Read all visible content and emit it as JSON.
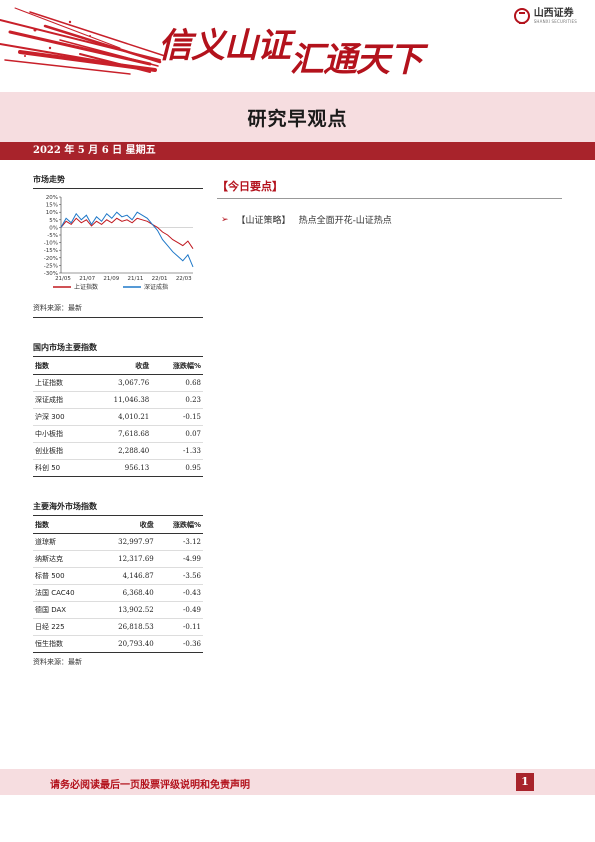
{
  "header": {
    "slogan_part1": "信义山证",
    "slogan_part2": "汇通天下",
    "logo_cn": "山西证券",
    "logo_en": "SHANXI SECURITIES"
  },
  "title": "研究早观点",
  "date_line": "2022 年 5 月 6 日    星期五",
  "market_trend": {
    "title": "市场走势",
    "source": "资料来源：最新",
    "chart_data": {
      "type": "line",
      "x": [
        "21/05",
        "21/07",
        "21/09",
        "21/11",
        "22/01",
        "22/03"
      ],
      "yticks": [
        "20%",
        "15%",
        "10%",
        "5%",
        "0%",
        "-5%",
        "-10%",
        "-15%",
        "-20%",
        "-25%",
        "-30%"
      ],
      "ylim": [
        -30,
        20
      ],
      "series": [
        {
          "name": "上证指数",
          "color": "#c0181f",
          "values": [
            0,
            4,
            2,
            6,
            3,
            5,
            1,
            4,
            2,
            5,
            3,
            6,
            4,
            5,
            3,
            6,
            5,
            4,
            2,
            0,
            -3,
            -5,
            -8,
            -10,
            -12,
            -9,
            -14
          ]
        },
        {
          "name": "深证成指",
          "color": "#1f78c8",
          "values": [
            0,
            6,
            3,
            9,
            5,
            8,
            2,
            7,
            4,
            9,
            6,
            10,
            7,
            8,
            5,
            10,
            8,
            6,
            2,
            -2,
            -8,
            -12,
            -16,
            -19,
            -22,
            -18,
            -26
          ]
        }
      ]
    }
  },
  "domestic": {
    "title": "国内市场主要指数",
    "headers": [
      "指数",
      "收盘",
      "涨跌幅%"
    ],
    "rows": [
      [
        "上证指数",
        "3,067.76",
        "0.68"
      ],
      [
        "深证成指",
        "11,046.38",
        "0.23"
      ],
      [
        "沪深 300",
        "4,010.21",
        "-0.15"
      ],
      [
        "中小板指",
        "7,618.68",
        "0.07"
      ],
      [
        "创业板指",
        "2,288.40",
        "-1.33"
      ],
      [
        "科创 50",
        "956.13",
        "0.95"
      ]
    ]
  },
  "overseas": {
    "title": "主要海外市场指数",
    "headers": [
      "指数",
      "收盘",
      "涨跌幅%"
    ],
    "rows": [
      [
        "道琼斯",
        "32,997.97",
        "-3.12"
      ],
      [
        "纳斯达克",
        "12,317.69",
        "-4.99"
      ],
      [
        "标普 500",
        "4,146.87",
        "-3.56"
      ],
      [
        "法国 CAC40",
        "6,368.40",
        "-0.43"
      ],
      [
        "德国 DAX",
        "13,902.52",
        "-0.49"
      ],
      [
        "日经 225",
        "26,818.53",
        "-0.11"
      ],
      [
        "恒生指数",
        "20,793.40",
        "-0.36"
      ]
    ],
    "source": "资料来源：最新"
  },
  "today": {
    "title": "【今日要点】",
    "items": [
      {
        "tag": "【山证策略】",
        "text": "热点全面开花-山证热点"
      }
    ]
  },
  "footer": {
    "disclaimer": "请务必阅读最后一页股票评级说明和免责声明",
    "page": "1"
  }
}
